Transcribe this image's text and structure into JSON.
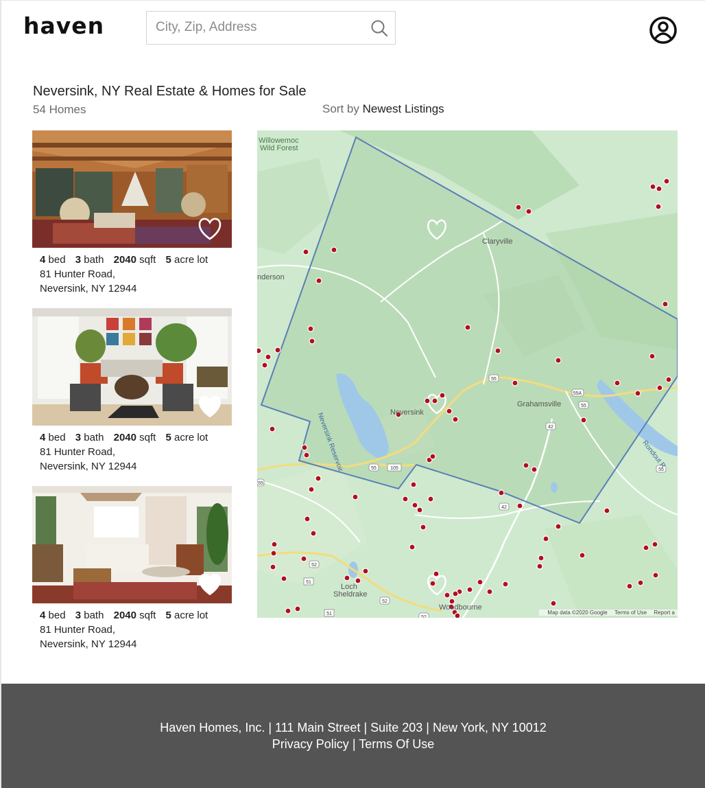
{
  "header": {
    "logo": "haven",
    "search_placeholder": "City, Zip, Address",
    "search_icon": "search-icon",
    "user_icon": "user-circle-icon"
  },
  "results": {
    "title": "Neversink, NY Real Estate & Homes for Sale",
    "count": "54 Homes",
    "sort_label": "Sort by",
    "sort_value": "Newest Listings"
  },
  "listings": [
    {
      "beds": "4",
      "beds_label": "bed",
      "baths": "3",
      "baths_label": "bath",
      "sqft": "2040",
      "sqft_label": "sqft",
      "lot": "5",
      "lot_label": "acre lot",
      "address_line1": "81 Hunter Road,",
      "address_line2": "Neversink, NY 12944",
      "favorited": false
    },
    {
      "beds": "4",
      "beds_label": "bed",
      "baths": "3",
      "baths_label": "bath",
      "sqft": "2040",
      "sqft_label": "sqft",
      "lot": "5",
      "lot_label": "acre lot",
      "address_line1": "81 Hunter Road,",
      "address_line2": "Neversink, NY 12944",
      "favorited": true
    },
    {
      "beds": "4",
      "beds_label": "bed",
      "baths": "3",
      "baths_label": "bath",
      "sqft": "2040",
      "sqft_label": "sqft",
      "lot": "5",
      "lot_label": "acre lot",
      "address_line1": "81 Hunter Road,",
      "address_line2": "Neversink, NY 12944",
      "favorited": true
    }
  ],
  "map": {
    "places": {
      "willowemoc": "Willowemoc",
      "wild_forest": "Wild Forest",
      "claryville": "Claryville",
      "anderson": "nderson",
      "neversink": "Neversink",
      "reservoir": "Neversink Reservoir",
      "grahamsville": "Grahamsville",
      "rondout": "Rondout R",
      "loch": "Loch",
      "sheldrake": "Sheldrake",
      "woodbourne": "Woodbourne"
    },
    "routes": [
      "55",
      "55A",
      "55",
      "42",
      "105",
      "55",
      "55",
      "42",
      "52",
      "51",
      "52",
      "51",
      "52",
      "55"
    ],
    "credit": "Map data ©2020 Google",
    "terms": "Terms of Use",
    "report": "Report a",
    "colors": {
      "land": "#cfe9cf",
      "boundary": "#5a7fb5",
      "water": "#9fc8e8",
      "marker": "#b01020"
    }
  },
  "footer": {
    "company": "Haven Homes, Inc.",
    "street": "111 Main Street",
    "suite": "Suite 203",
    "city": "New York, NY 10012",
    "separator": "|",
    "privacy": "Privacy Policy",
    "terms": "Terms Of Use"
  }
}
